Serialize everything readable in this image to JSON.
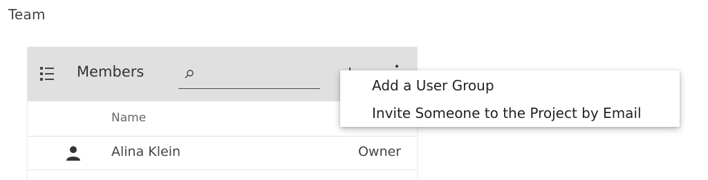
{
  "page": {
    "title": "Team"
  },
  "members_card": {
    "header": {
      "title": "Members",
      "search_placeholder": "",
      "list_icon": "list-icon",
      "menu_icon": "more-vert-icon"
    },
    "columns": {
      "name": "Name"
    },
    "rows": [
      {
        "icon": "person-icon",
        "name": "Alina Klein",
        "role": "Owner"
      }
    ]
  },
  "context_menu": {
    "items": [
      {
        "label": "Add a User Group"
      },
      {
        "label": "Invite Someone to the Project by Email"
      }
    ]
  },
  "colors": {
    "header_bg": "#e0e0e0",
    "text": "#333333",
    "menu_bg": "#ffffff"
  }
}
